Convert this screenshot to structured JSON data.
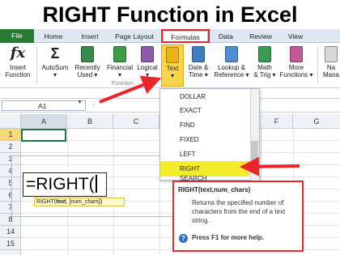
{
  "page_title": "RIGHT Function in Excel",
  "tabs": [
    "File",
    "Home",
    "Insert",
    "Page Layout",
    "Formulas",
    "Data",
    "Review",
    "View"
  ],
  "ribbon": {
    "insert_function": [
      "Insert",
      "Function"
    ],
    "autosum": [
      "AutoSum",
      "▾"
    ],
    "recently_used": [
      "Recently",
      "Used ▾"
    ],
    "financial": [
      "Financial",
      "▾"
    ],
    "logical": [
      "Logical",
      "▾"
    ],
    "text": [
      "Text",
      "▾"
    ],
    "date_time": [
      "Date &",
      "Time ▾"
    ],
    "lookup_reference": [
      "Lookup &",
      "Reference ▾"
    ],
    "math_trig": [
      "Math",
      "& Trig ▾"
    ],
    "more_functions": [
      "More",
      "Functions ▾"
    ],
    "name_manager": [
      "Na",
      "Mana"
    ],
    "group_label": "Function"
  },
  "name_box": "A1",
  "columns": [
    "A",
    "B",
    "C",
    "F",
    "G"
  ],
  "rows": [
    "1",
    "2",
    "3",
    "4",
    "5",
    "6",
    "7",
    "8",
    "9",
    "10",
    "11",
    "12",
    "13",
    "14",
    "15"
  ],
  "formula_text": "=RIGHT(",
  "tooltip": {
    "fn": "RIGHT(",
    "arg1": "text",
    "rest": ", [num_chars])"
  },
  "dropdown_items": [
    "DOLLAR",
    "EXACT",
    "FIND",
    "FIXED",
    "LEFT",
    "RIGHT",
    "SEARCH"
  ],
  "fn_panel": {
    "signature": "RIGHT(text,num_chars)",
    "description": "Returns the specified number of characters from the end of a text string.",
    "help": "Press F1 for more help."
  },
  "colors": {
    "accent_red": "#e8262c",
    "highlight_yellow": "#f3ec2b",
    "file_tab_green": "#2a7a36"
  }
}
